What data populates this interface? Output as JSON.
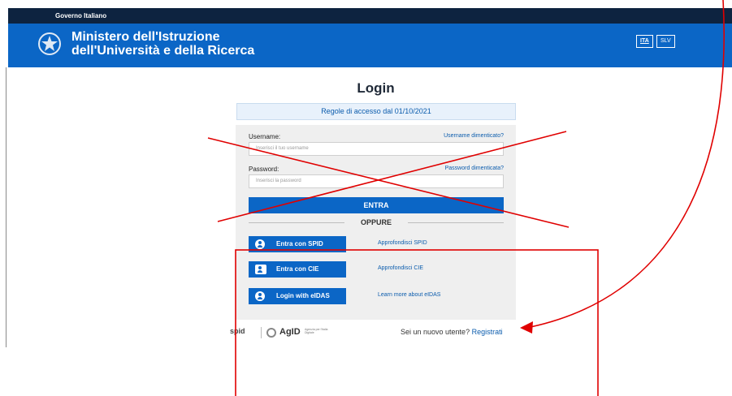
{
  "gov_bar": {
    "label": "Governo Italiano"
  },
  "header": {
    "title_line1": "Ministero dell'Istruzione",
    "title_line2": "dell'Università e della Ricerca",
    "lang_ita": "ITA",
    "lang_slv": "SLV"
  },
  "login": {
    "title": "Login",
    "rules_link": "Regole di accesso dal 01/10/2021",
    "username_label": "Username:",
    "username_forgot": "Username dimenticato?",
    "username_placeholder": "Inserisci il tuo username",
    "password_label": "Password:",
    "password_forgot": "Password dimenticata?",
    "password_placeholder": "Inserisci la password",
    "submit_label": "ENTRA",
    "divider_label": "OPPURE"
  },
  "identity_providers": [
    {
      "label": "Entra con SPID",
      "info": "Approfondisci SPID",
      "icon": "spid-user-icon"
    },
    {
      "label": "Entra con CIE",
      "info": "Approfondisci CIE",
      "icon": "cie-card-icon"
    },
    {
      "label": "Login with eIDAS",
      "info": "Learn more about eIDAS",
      "icon": "eidas-user-icon"
    }
  ],
  "footer": {
    "spid_logo": "spid",
    "agid_logo": "AgID",
    "agid_small": "Agenzia per l'Italia Digitale",
    "new_user_text": "Sei un nuovo utente?",
    "register_link": "Registrati"
  },
  "colors": {
    "gov_bar": "#0d2340",
    "brand_blue": "#0b66c6",
    "link_blue": "#0b5cad",
    "annotation_red": "#e00000"
  }
}
